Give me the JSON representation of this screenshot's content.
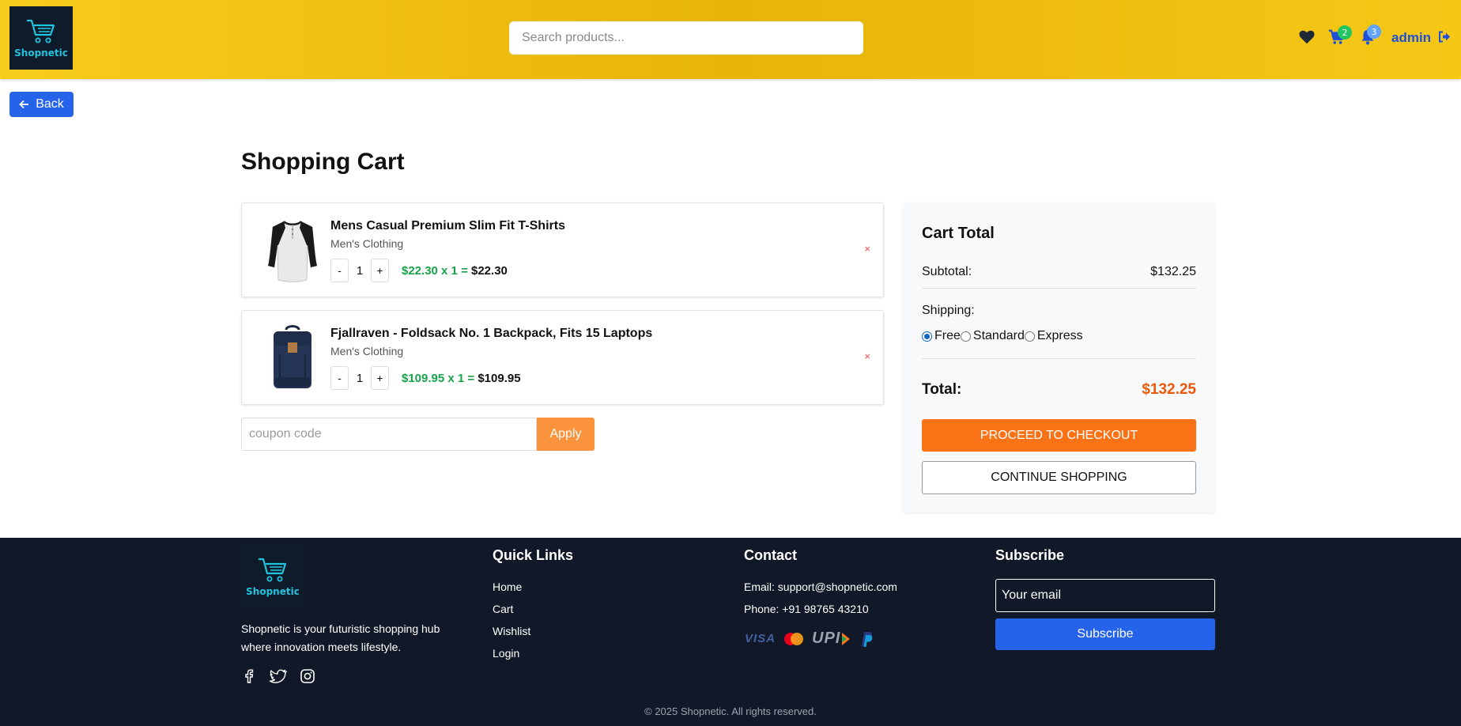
{
  "header": {
    "logo_text": "Shopnetic",
    "search_placeholder": "Search products...",
    "cart_count": "2",
    "notification_count": "3",
    "user_name": "admin",
    "colors": {
      "brand_yellow": "#f8cc1a",
      "badge_green": "#22c55e",
      "badge_blue": "#60a5fa",
      "user_blue": "#1d4fd8"
    }
  },
  "back_button": {
    "label": "Back"
  },
  "page_title": "Shopping Cart",
  "cart_items": [
    {
      "name": "Mens Casual Premium Slim Fit T-Shirts",
      "category": "Men's Clothing",
      "quantity": "1",
      "unit_price_expr": "$22.30 x 1 =",
      "line_total": "$22.30",
      "remove": "×",
      "image_icon": "tshirt-image"
    },
    {
      "name": "Fjallraven - Foldsack No. 1 Backpack, Fits 15 Laptops",
      "category": "Men's Clothing",
      "quantity": "1",
      "unit_price_expr": "$109.95 x 1 =",
      "line_total": "$109.95",
      "remove": "×",
      "image_icon": "backpack-image"
    }
  ],
  "qty_controls": {
    "minus": "-",
    "plus": "+"
  },
  "coupon": {
    "placeholder": "coupon code",
    "apply_label": "Apply"
  },
  "cart_total": {
    "title": "Cart Total",
    "subtotal_label": "Subtotal:",
    "subtotal_value": "$132.25",
    "shipping_label": "Shipping:",
    "shipping_options": [
      "Free",
      "Standard",
      "Express"
    ],
    "shipping_selected": "Free",
    "total_label": "Total:",
    "total_value": "$132.25",
    "checkout_label": "PROCEED TO CHECKOUT",
    "continue_label": "CONTINUE SHOPPING",
    "colors": {
      "checkout": "#f97316",
      "total_value": "#ea580c"
    }
  },
  "footer": {
    "logo_text": "Shopnetic",
    "about": "Shopnetic is your futuristic shopping hub where innovation meets lifestyle.",
    "social_icons": [
      "facebook-icon",
      "twitter-icon",
      "instagram-icon"
    ],
    "quick_links_title": "Quick Links",
    "quick_links": [
      "Home",
      "Cart",
      "Wishlist",
      "Login"
    ],
    "contact_title": "Contact",
    "contact_email": "Email: support@shopnetic.com",
    "contact_phone": "Phone: +91 98765 43210",
    "payment_icons": [
      "visa-icon",
      "mastercard-icon",
      "upi-icon",
      "paypal-icon"
    ],
    "payment_visa_text": "VISA",
    "payment_upi_text": "UPI",
    "subscribe_title": "Subscribe",
    "email_placeholder": "Your email",
    "subscribe_button": "Subscribe",
    "copyright": "© 2025 Shopnetic. All rights reserved."
  }
}
